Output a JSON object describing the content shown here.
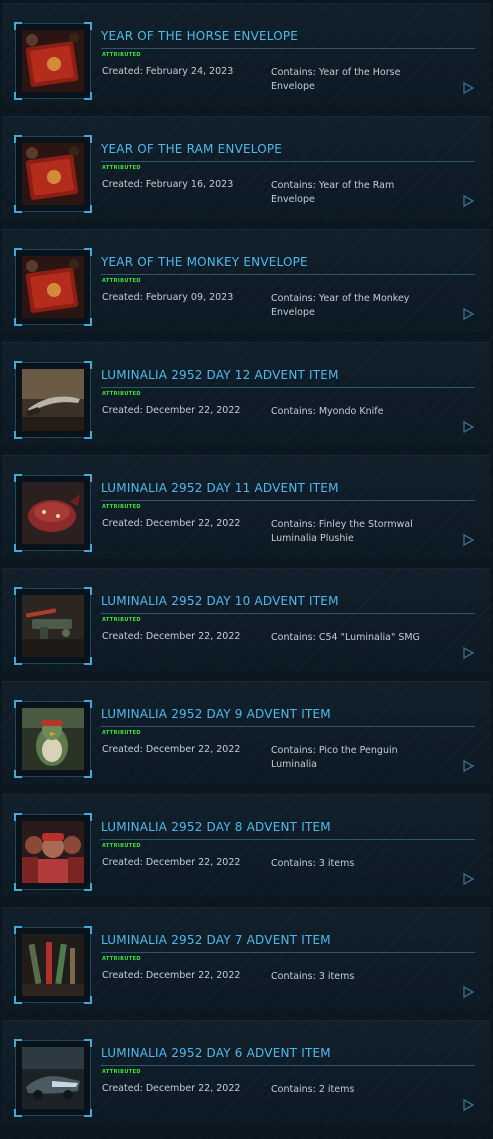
{
  "items": [
    {
      "title": "YEAR OF THE HORSE ENVELOPE",
      "status": "ATTRIBUTED",
      "created": "Created: February 24, 2023",
      "contains": "Contains: Year of the Horse Envelope",
      "thumbnail": "red-envelope-image"
    },
    {
      "title": "YEAR OF THE RAM ENVELOPE",
      "status": "ATTRIBUTED",
      "created": "Created: February 16, 2023",
      "contains": "Contains: Year of the Ram Envelope",
      "thumbnail": "red-envelope-image"
    },
    {
      "title": "YEAR OF THE MONKEY ENVELOPE",
      "status": "ATTRIBUTED",
      "created": "Created: February 09, 2023",
      "contains": "Contains: Year of the Monkey Envelope",
      "thumbnail": "red-envelope-image"
    },
    {
      "title": "LUMINALIA 2952 DAY 12 ADVENT ITEM",
      "status": "ATTRIBUTED",
      "created": "Created: December 22, 2022",
      "contains": "Contains: Myondo Knife",
      "thumbnail": "knife-image"
    },
    {
      "title": "LUMINALIA 2952 DAY 11 ADVENT ITEM",
      "status": "ATTRIBUTED",
      "created": "Created: December 22, 2022",
      "contains": "Contains: Finley the Stormwal Luminalia Plushie",
      "thumbnail": "plushie-image"
    },
    {
      "title": "LUMINALIA 2952 DAY 10 ADVENT ITEM",
      "status": "ATTRIBUTED",
      "created": "Created: December 22, 2022",
      "contains": "Contains: C54 \"Luminalia\" SMG",
      "thumbnail": "smg-image"
    },
    {
      "title": "LUMINALIA 2952 DAY 9 ADVENT ITEM",
      "status": "ATTRIBUTED",
      "created": "Created: December 22, 2022",
      "contains": "Contains: Pico the Penguin Luminalia",
      "thumbnail": "penguin-image"
    },
    {
      "title": "LUMINALIA 2952 DAY 8 ADVENT ITEM",
      "status": "ATTRIBUTED",
      "created": "Created: December 22, 2022",
      "contains": "Contains: 3 items",
      "thumbnail": "characters-image"
    },
    {
      "title": "LUMINALIA 2952 DAY 7 ADVENT ITEM",
      "status": "ATTRIBUTED",
      "created": "Created: December 22, 2022",
      "contains": "Contains: 3 items",
      "thumbnail": "weapons-image"
    },
    {
      "title": "LUMINALIA 2952 DAY 6 ADVENT ITEM",
      "status": "ATTRIBUTED",
      "created": "Created: December 22, 2022",
      "contains": "Contains: 2 items",
      "thumbnail": "vehicle-image"
    }
  ],
  "colors": {
    "title": "#4fb9ec",
    "status": "#3fe33a",
    "text": "#c4cdd3",
    "accent": "#47a8d6"
  },
  "icons": {
    "arrow": "play-arrow-icon"
  }
}
